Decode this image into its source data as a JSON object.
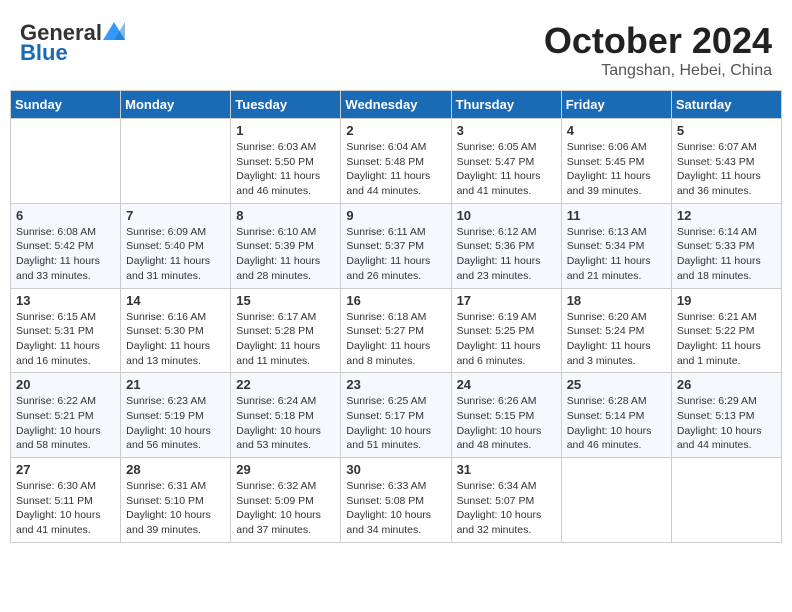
{
  "header": {
    "logo_general": "General",
    "logo_blue": "Blue",
    "month": "October 2024",
    "location": "Tangshan, Hebei, China"
  },
  "days_of_week": [
    "Sunday",
    "Monday",
    "Tuesday",
    "Wednesday",
    "Thursday",
    "Friday",
    "Saturday"
  ],
  "weeks": [
    [
      {
        "day": null
      },
      {
        "day": null
      },
      {
        "day": 1,
        "sunrise": "6:03 AM",
        "sunset": "5:50 PM",
        "daylight": "11 hours and 46 minutes."
      },
      {
        "day": 2,
        "sunrise": "6:04 AM",
        "sunset": "5:48 PM",
        "daylight": "11 hours and 44 minutes."
      },
      {
        "day": 3,
        "sunrise": "6:05 AM",
        "sunset": "5:47 PM",
        "daylight": "11 hours and 41 minutes."
      },
      {
        "day": 4,
        "sunrise": "6:06 AM",
        "sunset": "5:45 PM",
        "daylight": "11 hours and 39 minutes."
      },
      {
        "day": 5,
        "sunrise": "6:07 AM",
        "sunset": "5:43 PM",
        "daylight": "11 hours and 36 minutes."
      }
    ],
    [
      {
        "day": 6,
        "sunrise": "6:08 AM",
        "sunset": "5:42 PM",
        "daylight": "11 hours and 33 minutes."
      },
      {
        "day": 7,
        "sunrise": "6:09 AM",
        "sunset": "5:40 PM",
        "daylight": "11 hours and 31 minutes."
      },
      {
        "day": 8,
        "sunrise": "6:10 AM",
        "sunset": "5:39 PM",
        "daylight": "11 hours and 28 minutes."
      },
      {
        "day": 9,
        "sunrise": "6:11 AM",
        "sunset": "5:37 PM",
        "daylight": "11 hours and 26 minutes."
      },
      {
        "day": 10,
        "sunrise": "6:12 AM",
        "sunset": "5:36 PM",
        "daylight": "11 hours and 23 minutes."
      },
      {
        "day": 11,
        "sunrise": "6:13 AM",
        "sunset": "5:34 PM",
        "daylight": "11 hours and 21 minutes."
      },
      {
        "day": 12,
        "sunrise": "6:14 AM",
        "sunset": "5:33 PM",
        "daylight": "11 hours and 18 minutes."
      }
    ],
    [
      {
        "day": 13,
        "sunrise": "6:15 AM",
        "sunset": "5:31 PM",
        "daylight": "11 hours and 16 minutes."
      },
      {
        "day": 14,
        "sunrise": "6:16 AM",
        "sunset": "5:30 PM",
        "daylight": "11 hours and 13 minutes."
      },
      {
        "day": 15,
        "sunrise": "6:17 AM",
        "sunset": "5:28 PM",
        "daylight": "11 hours and 11 minutes."
      },
      {
        "day": 16,
        "sunrise": "6:18 AM",
        "sunset": "5:27 PM",
        "daylight": "11 hours and 8 minutes."
      },
      {
        "day": 17,
        "sunrise": "6:19 AM",
        "sunset": "5:25 PM",
        "daylight": "11 hours and 6 minutes."
      },
      {
        "day": 18,
        "sunrise": "6:20 AM",
        "sunset": "5:24 PM",
        "daylight": "11 hours and 3 minutes."
      },
      {
        "day": 19,
        "sunrise": "6:21 AM",
        "sunset": "5:22 PM",
        "daylight": "11 hours and 1 minute."
      }
    ],
    [
      {
        "day": 20,
        "sunrise": "6:22 AM",
        "sunset": "5:21 PM",
        "daylight": "10 hours and 58 minutes."
      },
      {
        "day": 21,
        "sunrise": "6:23 AM",
        "sunset": "5:19 PM",
        "daylight": "10 hours and 56 minutes."
      },
      {
        "day": 22,
        "sunrise": "6:24 AM",
        "sunset": "5:18 PM",
        "daylight": "10 hours and 53 minutes."
      },
      {
        "day": 23,
        "sunrise": "6:25 AM",
        "sunset": "5:17 PM",
        "daylight": "10 hours and 51 minutes."
      },
      {
        "day": 24,
        "sunrise": "6:26 AM",
        "sunset": "5:15 PM",
        "daylight": "10 hours and 48 minutes."
      },
      {
        "day": 25,
        "sunrise": "6:28 AM",
        "sunset": "5:14 PM",
        "daylight": "10 hours and 46 minutes."
      },
      {
        "day": 26,
        "sunrise": "6:29 AM",
        "sunset": "5:13 PM",
        "daylight": "10 hours and 44 minutes."
      }
    ],
    [
      {
        "day": 27,
        "sunrise": "6:30 AM",
        "sunset": "5:11 PM",
        "daylight": "10 hours and 41 minutes."
      },
      {
        "day": 28,
        "sunrise": "6:31 AM",
        "sunset": "5:10 PM",
        "daylight": "10 hours and 39 minutes."
      },
      {
        "day": 29,
        "sunrise": "6:32 AM",
        "sunset": "5:09 PM",
        "daylight": "10 hours and 37 minutes."
      },
      {
        "day": 30,
        "sunrise": "6:33 AM",
        "sunset": "5:08 PM",
        "daylight": "10 hours and 34 minutes."
      },
      {
        "day": 31,
        "sunrise": "6:34 AM",
        "sunset": "5:07 PM",
        "daylight": "10 hours and 32 minutes."
      },
      {
        "day": null
      },
      {
        "day": null
      }
    ]
  ]
}
